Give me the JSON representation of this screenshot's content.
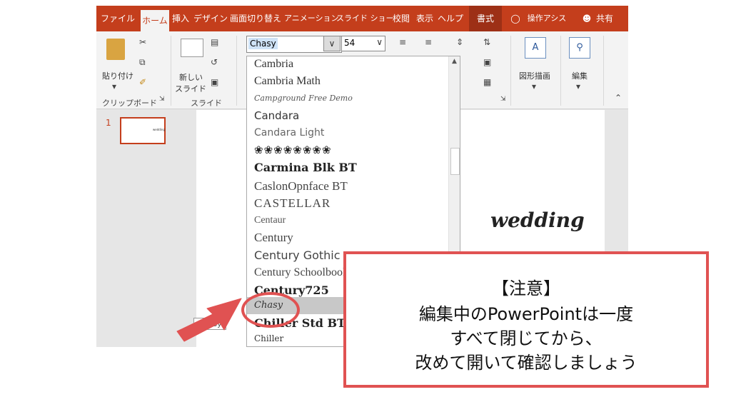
{
  "tabs": [
    {
      "label": "ファイル",
      "active": false
    },
    {
      "label": "ホーム",
      "active": true
    },
    {
      "label": "挿入",
      "active": false
    },
    {
      "label": "デザイン",
      "active": false
    },
    {
      "label": "画面切り替え",
      "active": false
    },
    {
      "label": "アニメーション",
      "active": false
    },
    {
      "label": "スライド ショー",
      "active": false
    },
    {
      "label": "校閲",
      "active": false
    },
    {
      "label": "表示",
      "active": false
    },
    {
      "label": "ヘルプ",
      "active": false
    },
    {
      "label": "書式",
      "active": false
    },
    {
      "label": "操作アシス",
      "active": false
    },
    {
      "label": "共有",
      "active": false
    }
  ],
  "ribbon": {
    "paste_label": "貼り付け",
    "new_slide_label_1": "新しい",
    "new_slide_label_2": "スライド",
    "clipboard_group": "クリップボード",
    "slides_group": "スライド",
    "draw_label": "図形描画",
    "edit_label": "編集",
    "font_value": "Chasy",
    "size_value": "54"
  },
  "slides_pane": {
    "number": "1",
    "thumb_text": "wedding"
  },
  "slide": {
    "text": "wedding"
  },
  "font_list": [
    "Cambria",
    "Cambria Math",
    "Campground Free Demo",
    "Candara",
    "Candara Light",
    "❀❀❀❀❀❀❀❀",
    "Carmina Blk BT",
    "CaslonOpnface BT",
    "CASTELLAR",
    "Centaur",
    "Century",
    "Century Gothic",
    "Century Schoolbook",
    "Century725",
    "Chasy",
    "Chiller Std BT",
    "Chiller"
  ],
  "tooltip": "Chasy",
  "notice": {
    "line1": "【注意】",
    "line2": "編集中のPowerPointは一度",
    "line3": "すべて閉じてから、",
    "line4": "改めて開いて確認しましょう"
  },
  "colors": {
    "accent": "#c43e1c",
    "callout": "#e05252",
    "selection": "#c8c8c8"
  }
}
